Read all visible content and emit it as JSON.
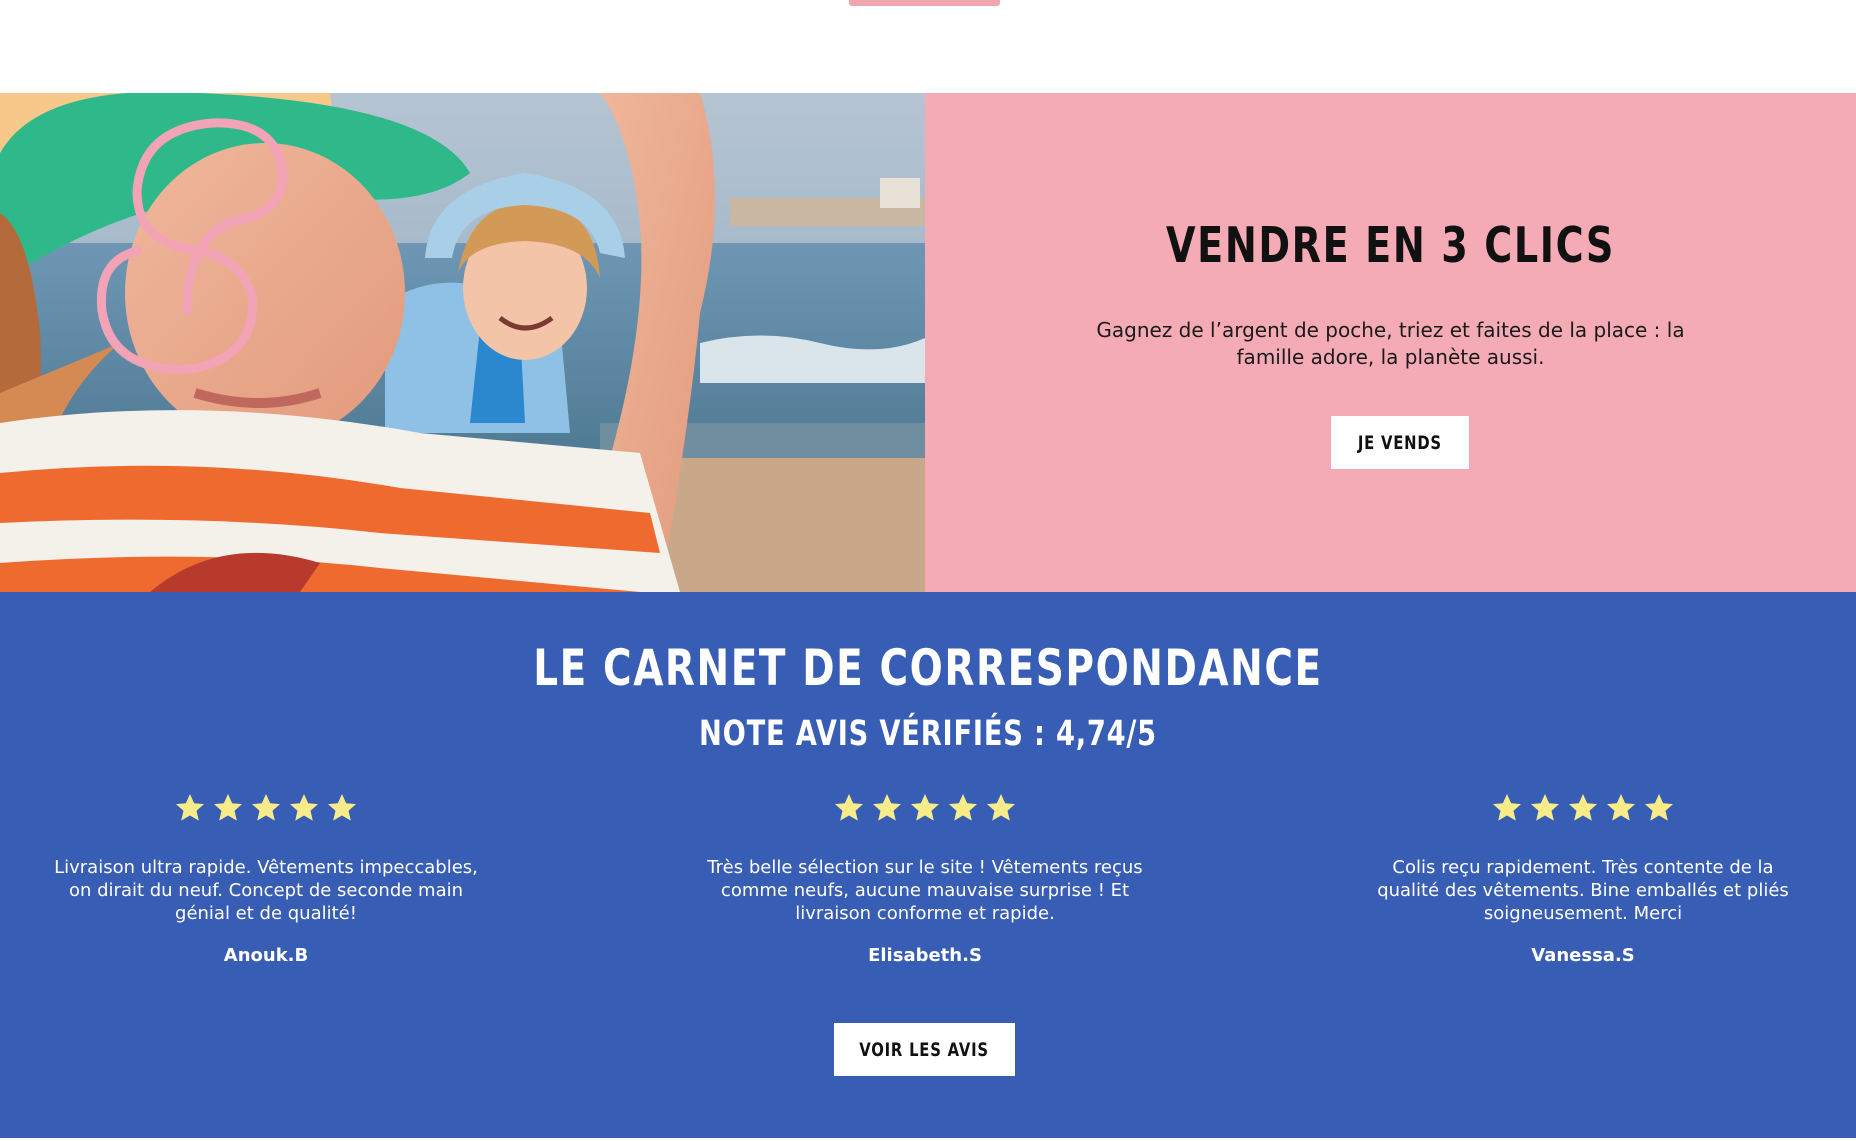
{
  "colors": {
    "accent_pink": "#f0a6b1",
    "hero_panel_bg": "#f4abb5",
    "reviews_bg": "#385db5",
    "star": "#f8ec8a",
    "button_bg": "#ffffff",
    "text_dark": "#111111"
  },
  "hero": {
    "image_alt": "photo-children-beach",
    "title": "VENDRE EN 3 CLICS",
    "text": "Gagnez de l’argent de poche, triez et faites de la place : la famille adore, la planète aussi.",
    "button_label": "JE VENDS"
  },
  "reviews": {
    "title": "LE CARNET DE CORRESPONDANCE",
    "subtitle": "NOTE AVIS VÉRIFIÉS : 4,74/5",
    "items": [
      {
        "rating": 5,
        "text": "Livraison ultra rapide. Vêtements impeccables, on dirait du neuf. Concept de seconde main génial et de qualité!",
        "author": "Anouk.B"
      },
      {
        "rating": 5,
        "text": "Très belle sélection sur le site ! Vêtements reçus comme neufs, aucune mauvaise surprise ! Et livraison conforme et rapide.",
        "author": "Elisabeth.S"
      },
      {
        "rating": 5,
        "text": "Colis reçu rapidement. Très contente de la qualité des vêtements. Bine emballés et pliés soigneusement. Merci",
        "author": "Vanessa.S"
      }
    ],
    "button_label": "VOIR LES AVIS"
  },
  "icons": {
    "logo": "swirl-logo-icon",
    "star": "star-icon"
  }
}
